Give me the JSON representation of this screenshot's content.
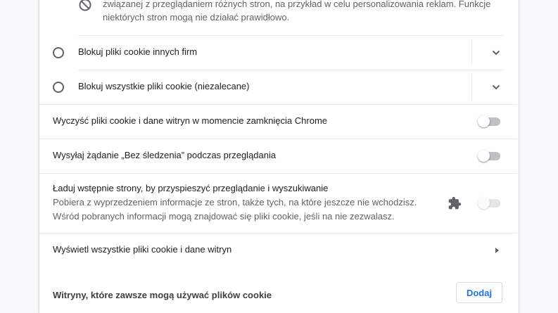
{
  "top_option": {
    "description_line1": "związanej z przeglądaniem różnych stron, na przykład w celu personalizowania reklam. Funkcje",
    "description_line2": "niektórych stron mogą nie działać prawidłowo.",
    "icon": "block-icon"
  },
  "radio_options": [
    {
      "label": "Blokuj pliki cookie innych firm",
      "selected": false
    },
    {
      "label": "Blokuj wszystkie pliki cookie (niezalecane)",
      "selected": false
    }
  ],
  "toggles": {
    "clear_on_exit": {
      "label": "Wyczyść pliki cookie i dane witryn w momencie zamknięcia Chrome",
      "on": false
    },
    "do_not_track": {
      "label": "Wysyłaj żądanie „Bez śledzenia” podczas przeglądania",
      "on": false
    },
    "preload": {
      "label": "Ładuj wstępnie strony, by przyspieszyć przeglądanie i wyszukiwanie",
      "description_line1": "Pobiera z wyprzedzeniem informacje ze stron, także tych, na które jeszcze nie wchodzisz.",
      "description_line2": "Wśród pobranych informacji mogą znajdować się pliki cookie, jeśli na nie zezwalasz.",
      "on": false,
      "disabled": true,
      "icon": "extension-puzzle-icon"
    }
  },
  "links": {
    "all_cookies": "Wyświetl wszystkie pliki cookie i dane witryn"
  },
  "always_allow": {
    "heading": "Witryny, które zawsze mogą używać plików cookie",
    "add_button": "Dodaj"
  },
  "colors": {
    "accent": "#1a73e8",
    "toggle_off_track": "#bdc1c6",
    "divider": "#e8eaed"
  }
}
